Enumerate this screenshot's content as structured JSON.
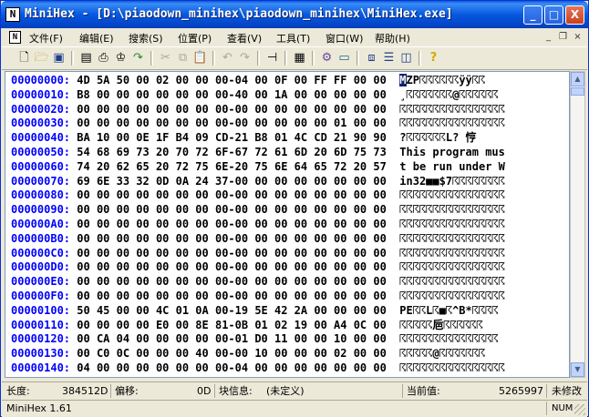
{
  "window": {
    "title": "MiniHex - [D:\\piaodown_minihex\\piaodown_minihex\\MiniHex.exe]",
    "app_icon": "N",
    "controls": {
      "minimize": "_",
      "maximize": "□",
      "close": "X"
    }
  },
  "menu": {
    "doc_icon": "N",
    "items": [
      "文件(F)",
      "编辑(E)",
      "搜索(S)",
      "位置(P)",
      "查看(V)",
      "工具(T)",
      "窗口(W)",
      "帮助(H)"
    ],
    "mdi": {
      "minimize": "_",
      "restore": "❐",
      "close": "×"
    }
  },
  "toolbar": {
    "icons": [
      "new-file-icon",
      "open-folder-icon",
      "save-icon",
      "properties-icon",
      "print-icon",
      "find-icon",
      "goto-icon",
      "cut-icon",
      "copy-icon",
      "paste-icon",
      "undo-icon",
      "redo-icon",
      "bookmark-icon",
      "view-icon",
      "settings-icon",
      "calculator-icon",
      "tile-icon",
      "horizontal-icon",
      "vertical-icon",
      "help-icon"
    ]
  },
  "hex": {
    "rows": [
      {
        "addr": "00000000:",
        "bytes": "4D 5A 50 00 02 00 00 00-04 00 0F 00 FF FF 00 00",
        "text": "MZP☈☈☈☈☈☈ÿÿ☈☈"
      },
      {
        "addr": "00000010:",
        "bytes": "B8 00 00 00 00 00 00 00-40 00 1A 00 00 00 00 00",
        "text": "¸☈☈☈☈☈☈☈@☈☈☈☈☈☈"
      },
      {
        "addr": "00000020:",
        "bytes": "00 00 00 00 00 00 00 00-00 00 00 00 00 00 00 00",
        "text": "☈☈☈☈☈☈☈☈☈☈☈☈☈☈☈☈"
      },
      {
        "addr": "00000030:",
        "bytes": "00 00 00 00 00 00 00 00-00 00 00 00 00 01 00 00",
        "text": "☈☈☈☈☈☈☈☈☈☈☈☈☈☈☈☈"
      },
      {
        "addr": "00000040:",
        "bytes": "BA 10 00 0E 1F B4 09 CD-21 B8 01 4C CD 21 90 90",
        "text": "?☈☈☈☈☈☈L? 悙"
      },
      {
        "addr": "00000050:",
        "bytes": "54 68 69 73 20 70 72 6F-67 72 61 6D 20 6D 75 73",
        "text": "This program mus"
      },
      {
        "addr": "00000060:",
        "bytes": "74 20 62 65 20 72 75 6E-20 75 6E 64 65 72 20 57",
        "text": "t be run under W"
      },
      {
        "addr": "00000070:",
        "bytes": "69 6E 33 32 0D 0A 24 37-00 00 00 00 00 00 00 00",
        "text": "in32■■$7☈☈☈☈☈☈☈☈"
      },
      {
        "addr": "00000080:",
        "bytes": "00 00 00 00 00 00 00 00-00 00 00 00 00 00 00 00",
        "text": "☈☈☈☈☈☈☈☈☈☈☈☈☈☈☈☈"
      },
      {
        "addr": "00000090:",
        "bytes": "00 00 00 00 00 00 00 00-00 00 00 00 00 00 00 00",
        "text": "☈☈☈☈☈☈☈☈☈☈☈☈☈☈☈☈"
      },
      {
        "addr": "000000A0:",
        "bytes": "00 00 00 00 00 00 00 00-00 00 00 00 00 00 00 00",
        "text": "☈☈☈☈☈☈☈☈☈☈☈☈☈☈☈☈"
      },
      {
        "addr": "000000B0:",
        "bytes": "00 00 00 00 00 00 00 00-00 00 00 00 00 00 00 00",
        "text": "☈☈☈☈☈☈☈☈☈☈☈☈☈☈☈☈"
      },
      {
        "addr": "000000C0:",
        "bytes": "00 00 00 00 00 00 00 00-00 00 00 00 00 00 00 00",
        "text": "☈☈☈☈☈☈☈☈☈☈☈☈☈☈☈☈"
      },
      {
        "addr": "000000D0:",
        "bytes": "00 00 00 00 00 00 00 00-00 00 00 00 00 00 00 00",
        "text": "☈☈☈☈☈☈☈☈☈☈☈☈☈☈☈☈"
      },
      {
        "addr": "000000E0:",
        "bytes": "00 00 00 00 00 00 00 00-00 00 00 00 00 00 00 00",
        "text": "☈☈☈☈☈☈☈☈☈☈☈☈☈☈☈☈"
      },
      {
        "addr": "000000F0:",
        "bytes": "00 00 00 00 00 00 00 00-00 00 00 00 00 00 00 00",
        "text": "☈☈☈☈☈☈☈☈☈☈☈☈☈☈☈☈"
      },
      {
        "addr": "00000100:",
        "bytes": "50 45 00 00 4C 01 0A 00-19 5E 42 2A 00 00 00 00",
        "text": "PE☈☈L☈■☈^B*☈☈☈☈"
      },
      {
        "addr": "00000110:",
        "bytes": "00 00 00 00 E0 00 8E 81-0B 01 02 19 00 A4 0C 00",
        "text": "☈☈☈☈☈巵☈☈☈☈☈☈"
      },
      {
        "addr": "00000120:",
        "bytes": "00 CA 04 00 00 00 00 00-01 D0 11 00 00 10 00 00",
        "text": "☈☈☈☈☈☈☈☈☈☈☈☈☈☈☈"
      },
      {
        "addr": "00000130:",
        "bytes": "00 C0 0C 00 00 00 40 00-00 10 00 00 00 02 00 00",
        "text": "☈☈☈☈☈@☈☈☈☈☈☈☈"
      },
      {
        "addr": "00000140:",
        "bytes": "04 00 00 00 00 00 00 00-04 00 00 00 00 00 00 00",
        "text": "☈☈☈☈☈☈☈☈☈☈☈☈☈☈☈☈"
      }
    ]
  },
  "status": {
    "length_label": "长度:",
    "length_value": "384512D",
    "offset_label": "偏移:",
    "offset_value": "0D",
    "block_label": "块信息:",
    "block_value": "(未定义)",
    "current_label": "当前值:",
    "current_value": "5265997",
    "modified": "未修改",
    "version": "MiniHex 1.61",
    "numlock": "NUM"
  }
}
